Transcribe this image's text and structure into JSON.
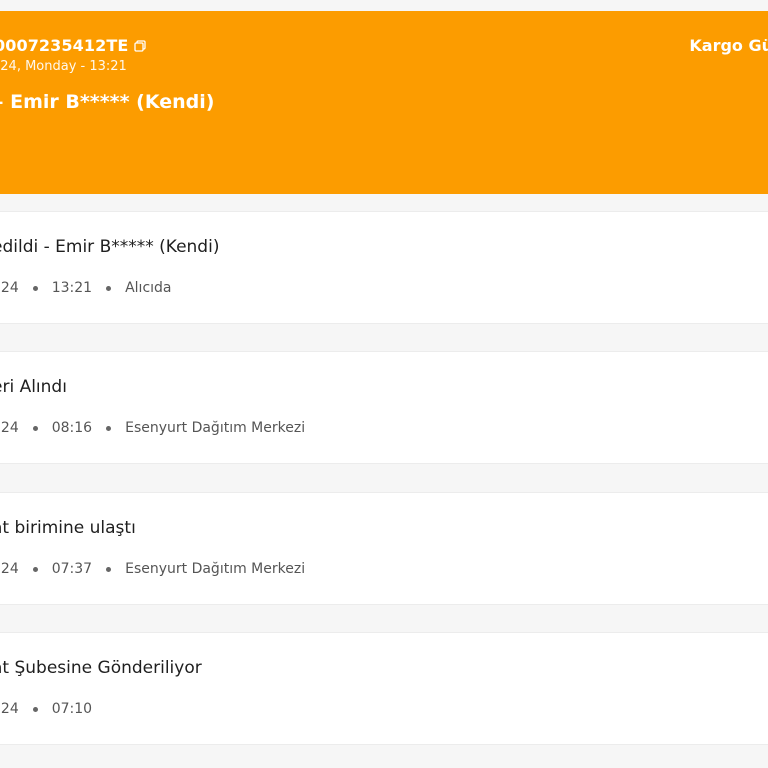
{
  "header": {
    "tracking_number": "0007235412TE",
    "datetime": "024, Monday - 13:21",
    "recipient": "– Emir B***** (Kendi)",
    "cargo_link": "Kargo Gü",
    "background_color": "#fc9c00"
  },
  "events": [
    {
      "title": "edildi - Emir B***** (Kendi)",
      "date": "024",
      "time": "13:21",
      "location": "Alıcıda"
    },
    {
      "title": "eri Alındı",
      "date": "024",
      "time": "08:16",
      "location": "Esenyurt Dağıtım Merkezi"
    },
    {
      "title": "at birimine ulaştı",
      "date": "024",
      "time": "07:37",
      "location": "Esenyurt Dağıtım Merkezi"
    },
    {
      "title": "at Şubesine Gönderiliyor",
      "date": "024",
      "time": "07:10",
      "location": ""
    }
  ]
}
